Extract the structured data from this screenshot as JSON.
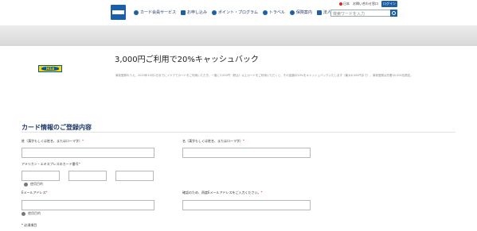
{
  "header": {
    "logo_text": "AMERICAN EXPRESS",
    "nav": [
      {
        "label": "カード会員サービス",
        "icon": "user-icon"
      },
      {
        "label": "お申し込み",
        "icon": "card-icon"
      },
      {
        "label": "ポイント・プログラム",
        "icon": "point-icon"
      },
      {
        "label": "トラベル",
        "icon": "plane-icon"
      },
      {
        "label": "保険案内",
        "icon": "shield-icon"
      },
      {
        "label": "法人／加盟店",
        "icon": "building-icon"
      }
    ],
    "utility": {
      "region": "日本",
      "contact": "お問い合わせ窓口",
      "login": "ログイン"
    },
    "search": {
      "placeholder": "検索ワードを入力"
    }
  },
  "promo": {
    "brand": "IKEA",
    "title": "3,000円ご利用で20%キャッシュバック",
    "description": "事前登録のうえ、2019年10月1日までにイケアでカードをご利用いただき、一度に3,000円（税込）以上カードをご利用いただくと、その金額の20%をキャッシュバックいたします（最大6,000円まで）。事前登録は先着40,000名限定。"
  },
  "form": {
    "title": "カード情報のご登録内容",
    "fields": {
      "last_name": "姓（漢字もしくは姓名、またはローマ字）",
      "first_name": "名（漢字もしくは姓名、またはローマ字）",
      "card_number": "アメリカン・エキスプレスのカード番号",
      "email": "Eメールアドレス",
      "email_confirm": "確認のため、再度Eメールアドレスをご入力ください。"
    },
    "required_mark": "*",
    "usage_hint_1": "使用目的",
    "usage_hint_2": "使用目的",
    "required_note": "* 必須項目"
  }
}
